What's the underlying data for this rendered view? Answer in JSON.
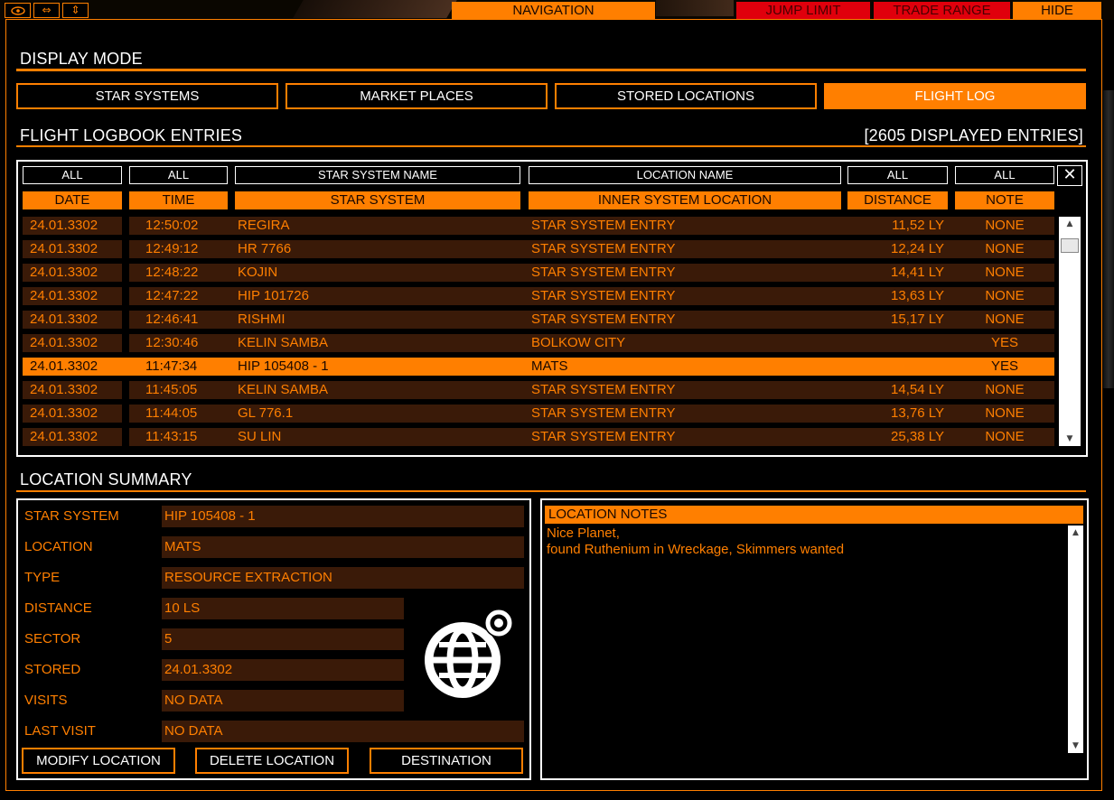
{
  "topbar": {
    "icons": [
      "eye-icon",
      "horizontal-resize-icon",
      "vertical-resize-icon"
    ],
    "navigation": "NAVIGATION",
    "jump_limit": "JUMP LIMIT",
    "trade_range": "TRADE RANGE",
    "hide": "HIDE"
  },
  "display_mode": {
    "title": "DISPLAY MODE",
    "buttons": [
      "STAR SYSTEMS",
      "MARKET PLACES",
      "STORED LOCATIONS",
      "FLIGHT LOG"
    ],
    "active": "FLIGHT LOG"
  },
  "logbook": {
    "title": "FLIGHT LOGBOOK ENTRIES",
    "count": "[2605 DISPLAYED ENTRIES]",
    "filters": [
      "ALL",
      "ALL",
      "STAR SYSTEM NAME",
      "LOCATION NAME",
      "ALL",
      "ALL"
    ],
    "clear_icon": "close-icon",
    "clear_glyph": "✕",
    "columns": [
      "DATE",
      "TIME",
      "STAR SYSTEM",
      "INNER SYSTEM LOCATION",
      "DISTANCE",
      "NOTE"
    ],
    "rows": [
      [
        "24.01.3302",
        "12:50:02",
        "REGIRA",
        "STAR SYSTEM ENTRY",
        "11,52 LY",
        "NONE"
      ],
      [
        "24.01.3302",
        "12:49:12",
        "HR 7766",
        "STAR SYSTEM ENTRY",
        "12,24 LY",
        "NONE"
      ],
      [
        "24.01.3302",
        "12:48:22",
        "KOJIN",
        "STAR SYSTEM ENTRY",
        "14,41 LY",
        "NONE"
      ],
      [
        "24.01.3302",
        "12:47:22",
        "HIP 101726",
        "STAR SYSTEM ENTRY",
        "13,63 LY",
        "NONE"
      ],
      [
        "24.01.3302",
        "12:46:41",
        "RISHMI",
        "STAR SYSTEM ENTRY",
        "15,17 LY",
        "NONE"
      ],
      [
        "24.01.3302",
        "12:30:46",
        "KELIN SAMBA",
        "BOLKOW CITY",
        "",
        "YES"
      ],
      [
        "24.01.3302",
        "11:47:34",
        "HIP 105408 - 1",
        "MATS",
        "",
        "YES"
      ],
      [
        "24.01.3302",
        "11:45:05",
        "KELIN SAMBA",
        "STAR SYSTEM ENTRY",
        "14,54 LY",
        "NONE"
      ],
      [
        "24.01.3302",
        "11:44:05",
        "GL 776.1",
        "STAR SYSTEM ENTRY",
        "13,76 LY",
        "NONE"
      ],
      [
        "24.01.3302",
        "11:43:15",
        "SU LIN",
        "STAR SYSTEM ENTRY",
        "25,38 LY",
        "NONE"
      ]
    ],
    "selected_row": 6
  },
  "summary": {
    "title": "LOCATION SUMMARY",
    "fields": [
      {
        "label": "STAR SYSTEM",
        "value": "HIP 105408 - 1"
      },
      {
        "label": "LOCATION",
        "value": "MATS"
      },
      {
        "label": "TYPE",
        "value": "RESOURCE EXTRACTION"
      },
      {
        "label": "DISTANCE",
        "value": "10 LS"
      },
      {
        "label": "SECTOR",
        "value": "5"
      },
      {
        "label": "STORED",
        "value": "24.01.3302"
      },
      {
        "label": "VISITS",
        "value": "NO DATA"
      },
      {
        "label": "LAST VISIT",
        "value": "NO DATA"
      }
    ],
    "globe_icon": "globe-location-icon",
    "buttons": [
      "MODIFY LOCATION",
      "DELETE LOCATION",
      "DESTINATION"
    ]
  },
  "notes": {
    "title": "LOCATION NOTES",
    "lines": [
      "Nice Planet,",
      "found Ruthenium in Wreckage, Skimmers wanted"
    ]
  },
  "colors": {
    "accent": "#ff7f00",
    "row_bg": "#3a1a08",
    "alert": "#e0000c",
    "text_white": "#ffffff"
  }
}
